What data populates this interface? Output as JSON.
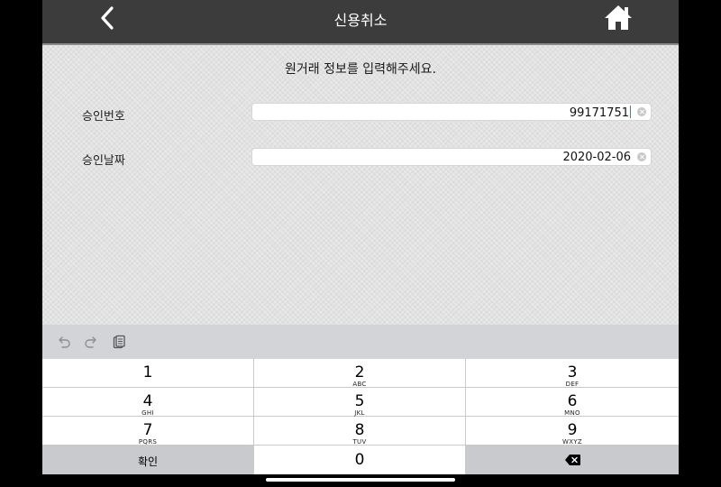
{
  "header": {
    "title": "신용취소",
    "back_icon": "chevron-left-icon",
    "home_icon": "home-icon"
  },
  "content": {
    "prompt": "원거래 정보를 입력해주세요.",
    "fields": [
      {
        "label": "승인번호",
        "value": "99171751"
      },
      {
        "label": "승인날짜",
        "value": "2020-02-06"
      }
    ]
  },
  "toolbar": {
    "icons": [
      "undo-icon",
      "redo-icon",
      "paste-icon"
    ]
  },
  "keypad": {
    "keys": [
      {
        "num": "1",
        "sub": ""
      },
      {
        "num": "2",
        "sub": "ABC"
      },
      {
        "num": "3",
        "sub": "DEF"
      },
      {
        "num": "4",
        "sub": "GHI"
      },
      {
        "num": "5",
        "sub": "JKL"
      },
      {
        "num": "6",
        "sub": "MNO"
      },
      {
        "num": "7",
        "sub": "PQRS"
      },
      {
        "num": "8",
        "sub": "TUV"
      },
      {
        "num": "9",
        "sub": "WXYZ"
      }
    ],
    "confirm_label": "확인",
    "zero": "0",
    "delete_icon": "backspace-icon"
  },
  "colors": {
    "header_bg": "#3c3c3c",
    "content_bg": "#e2e2e2",
    "keypad_bg": "#c9cace",
    "caret": "#3b7bf6"
  }
}
